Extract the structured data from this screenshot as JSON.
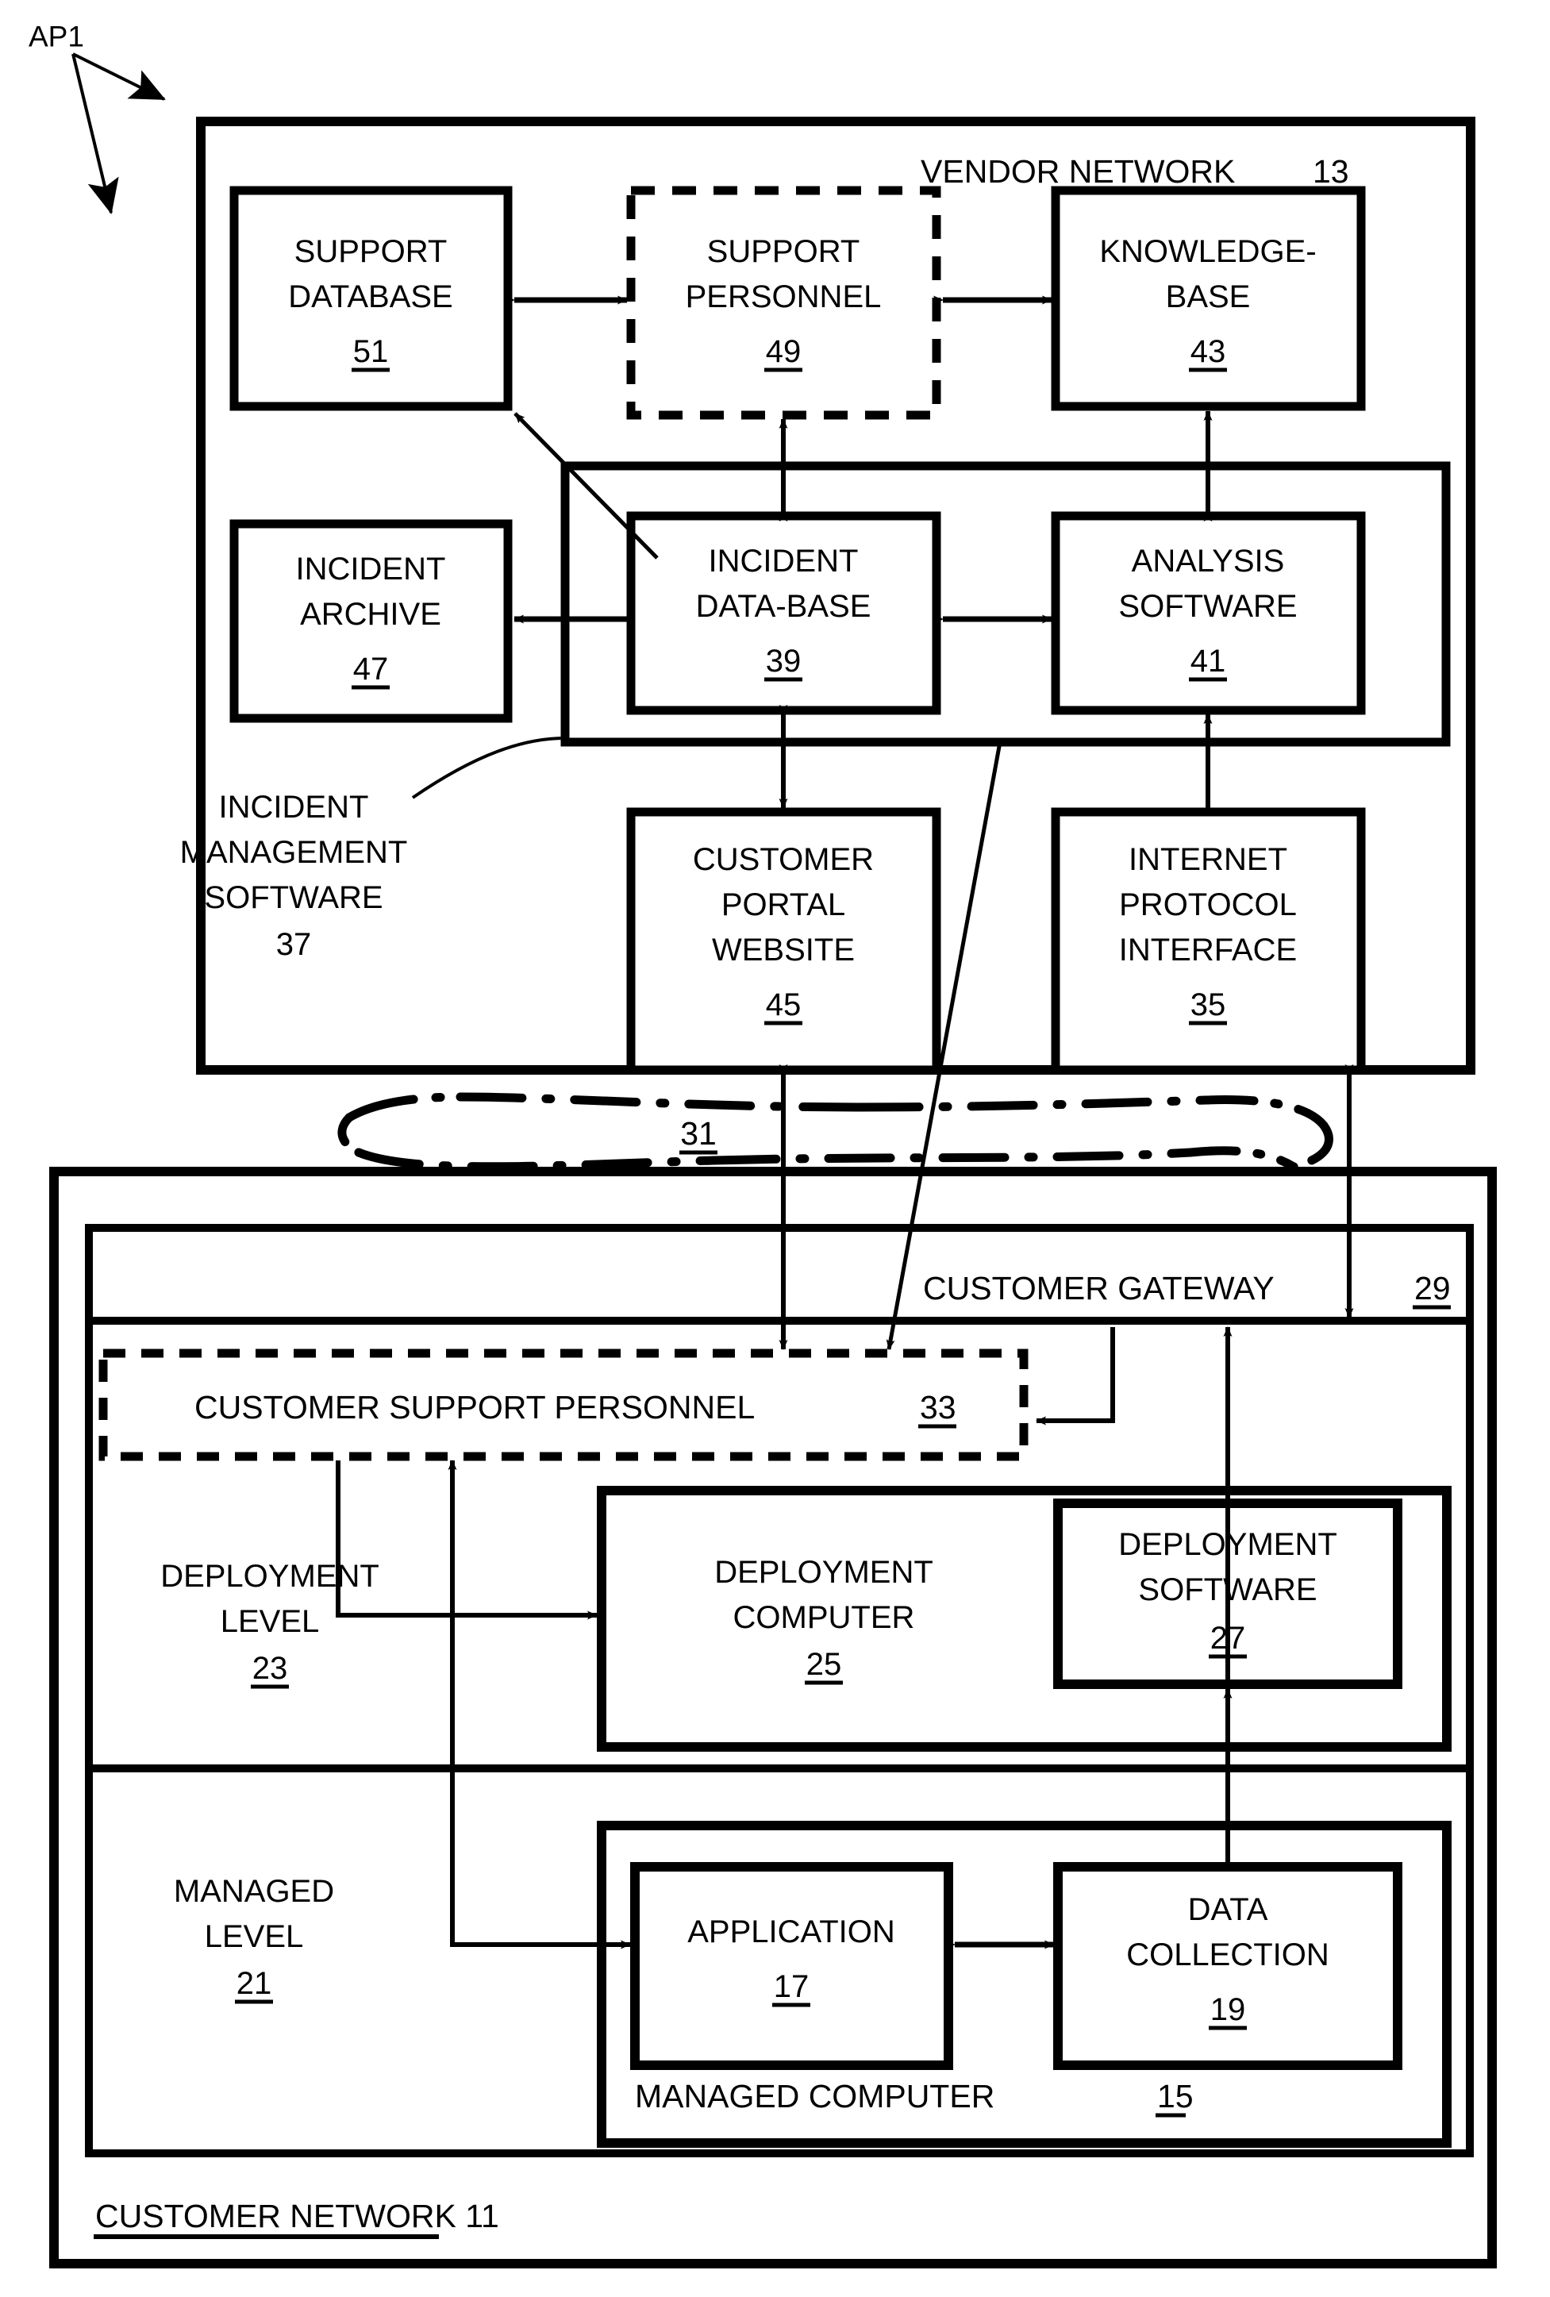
{
  "figure": {
    "callout": "AP1",
    "vendor_network": {
      "title": "VENDOR  NETWORK",
      "ref": "13",
      "boxes": {
        "support_database": {
          "line1": "SUPPORT",
          "line2": "DATABASE",
          "ref": "51"
        },
        "support_personnel": {
          "line1": "SUPPORT",
          "line2": "PERSONNEL",
          "ref": "49"
        },
        "knowledge_base": {
          "line1": "KNOWLEDGE-",
          "line2": "BASE",
          "ref": "43"
        },
        "incident_archive": {
          "line1": "INCIDENT",
          "line2": "ARCHIVE",
          "ref": "47"
        },
        "incident_database": {
          "line1": "INCIDENT",
          "line2": "DATA-BASE",
          "ref": "39"
        },
        "analysis_software": {
          "line1": "ANALYSIS",
          "line2": "SOFTWARE",
          "ref": "41"
        },
        "customer_portal_website": {
          "line1": "CUSTOMER",
          "line2": "PORTAL",
          "line3": "WEBSITE",
          "ref": "45"
        },
        "internet_protocol_interface": {
          "line1": "INTERNET",
          "line2": "PROTOCOL",
          "line3": "INTERFACE",
          "ref": "35"
        }
      },
      "incident_management_software": {
        "line1": "INCIDENT",
        "line2": "MANAGEMENT",
        "line3": "SOFTWARE",
        "ref": "37"
      }
    },
    "network_cloud": {
      "ref": "31"
    },
    "customer_network": {
      "title": "CUSTOMER NETWORK 11",
      "ref": "11",
      "customer_gateway": {
        "title": "CUSTOMER GATEWAY",
        "ref": "29"
      },
      "customer_support_personnel": {
        "title": "CUSTOMER SUPPORT PERSONNEL",
        "ref": "33"
      },
      "deployment_level": {
        "line1": "DEPLOYMENT",
        "line2": "LEVEL",
        "ref": "23"
      },
      "managed_level": {
        "line1": "MANAGED",
        "line2": "LEVEL",
        "ref": "21"
      },
      "boxes": {
        "deployment_computer": {
          "line1": "DEPLOYMENT",
          "line2": "COMPUTER",
          "ref": "25"
        },
        "deployment_software": {
          "line1": "DEPLOYMENT",
          "line2": "SOFTWARE",
          "ref": "27"
        },
        "application": {
          "line1": "APPLICATION",
          "ref": "17"
        },
        "data_collection": {
          "line1": "DATA",
          "line2": "COLLECTION",
          "ref": "19"
        },
        "managed_computer": {
          "title": "MANAGED COMPUTER",
          "ref": "15"
        }
      }
    },
    "colors": {
      "stroke": "#000000",
      "fill": "#ffffff"
    }
  }
}
